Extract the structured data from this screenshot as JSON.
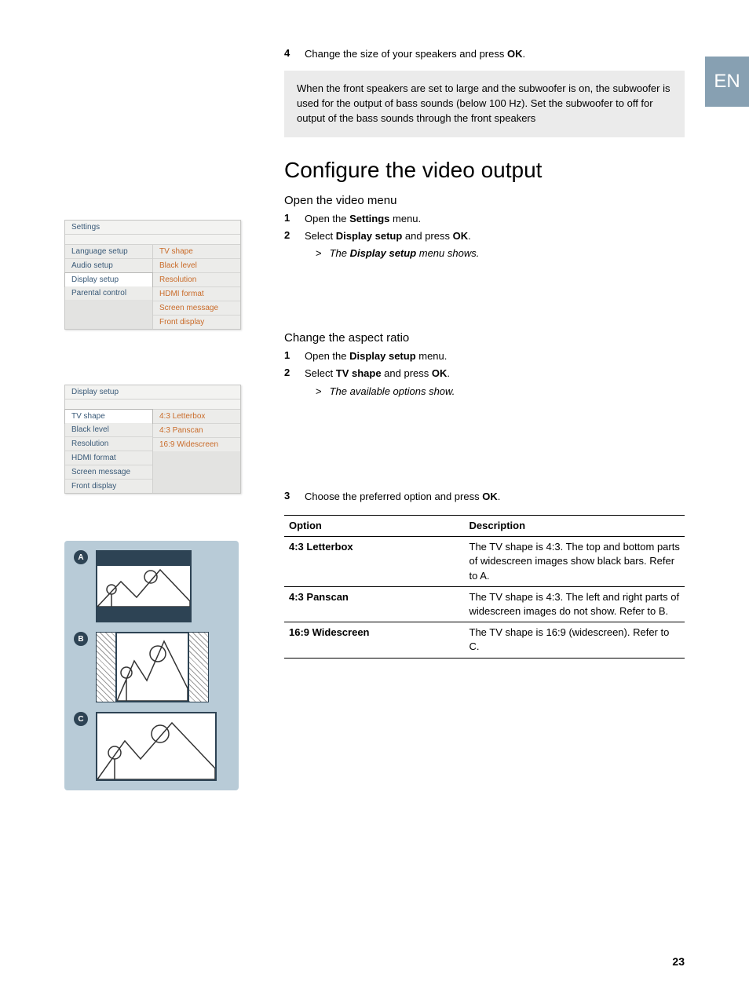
{
  "lang_tab": "EN",
  "page_number": "23",
  "intro_step": {
    "num": "4",
    "prefix": "Change the size of your speakers and press ",
    "bold": "OK",
    "suffix": "."
  },
  "note": "When the front speakers are set to large and the subwoofer is on, the subwoofer is used for the output of bass sounds (below 100 Hz). Set the subwoofer to off for output of the bass sounds through the front speakers",
  "section_title": "Configure the video output",
  "open_video": {
    "heading": "Open the video menu",
    "step1": {
      "num": "1",
      "prefix": "Open the ",
      "b": "Settings",
      "suffix": " menu."
    },
    "step2": {
      "num": "2",
      "prefix": "Select ",
      "b1": "Display setup",
      "mid": " and press ",
      "b2": "OK",
      "suffix": "."
    },
    "result_prefix": "The ",
    "result_bold": "Display setup",
    "result_suffix": " menu shows."
  },
  "aspect": {
    "heading": "Change the aspect ratio",
    "step1": {
      "num": "1",
      "prefix": "Open the ",
      "b": "Display setup",
      "suffix": " menu."
    },
    "step2": {
      "num": "2",
      "prefix": "Select ",
      "b1": "TV shape",
      "mid": " and press ",
      "b2": "OK",
      "suffix": "."
    },
    "result": "The available options show."
  },
  "step3": {
    "num": "3",
    "prefix": "Choose the preferred option and press ",
    "b": "OK",
    "suffix": "."
  },
  "table": {
    "h1": "Option",
    "h2": "Description",
    "rows": [
      {
        "opt": "4:3 Letterbox",
        "desc": "The TV shape is 4:3. The top and bottom parts of widescreen images show black bars. Refer to A."
      },
      {
        "opt": "4:3 Panscan",
        "desc": "The TV shape is 4:3. The left and right parts of widescreen images do not show. Refer to B."
      },
      {
        "opt": "16:9 Widescreen",
        "desc": "The TV shape is 16:9 (widescreen). Refer to C."
      }
    ]
  },
  "menu1": {
    "title": "Settings",
    "left": [
      "Language setup",
      "Audio setup",
      "Display setup",
      "Parental control"
    ],
    "right": [
      "TV shape",
      "Black level",
      "Resolution",
      "HDMI format",
      "Screen message",
      "Front display"
    ],
    "left_selected_index": 2
  },
  "menu2": {
    "title": "Display setup",
    "left": [
      "TV shape",
      "Black level",
      "Resolution",
      "HDMI format",
      "Screen message",
      "Front display"
    ],
    "right": [
      "4:3 Letterbox",
      "4:3 Panscan",
      "16:9 Widescreen"
    ],
    "left_selected_index": 0
  },
  "tv_labels": [
    "A",
    "B",
    "C"
  ]
}
